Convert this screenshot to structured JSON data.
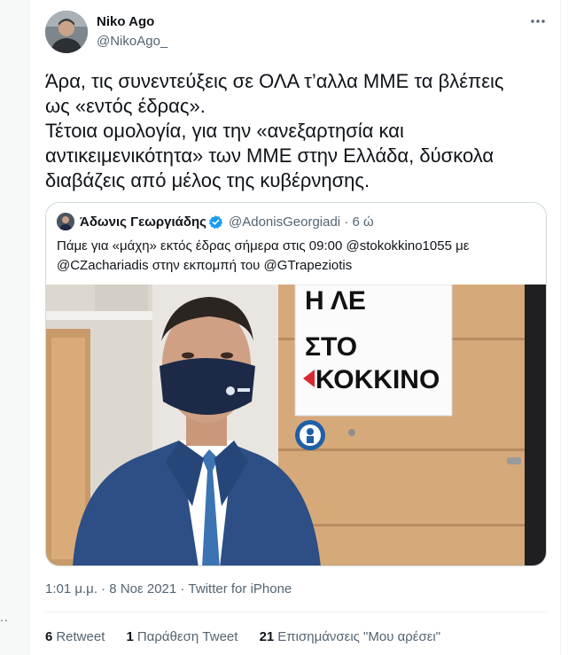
{
  "tweet": {
    "author_name": "Niko Ago",
    "author_handle": "@NikoAgo_",
    "more_icon": "more-horizontal-icon",
    "text_lines": [
      "Άρα, τις συνεντεύξεις σε ΟΛΑ τ’αλλα ΜΜΕ τα βλέπεις",
      "ως «εντός έδρας».",
      "Τέτοια ομολογία, για την «ανεξαρτησία και",
      "αντικειμενικότητα» των ΜΜΕ στην Ελλάδα, δύσκολα",
      "διαβάζεις από μέλος της κυβέρνησης."
    ],
    "timestamp": "1:01 μ.μ. · 8 Νοε 2021 · Twitter for iPhone"
  },
  "quote": {
    "author_name": "Άδωνις Γεωργιάδης",
    "meta": "@AdonisGeorgiadi · 6 ώ",
    "verified_icon": "verified-badge-icon",
    "text_line1": "Πάμε για «μάχη» εκτός έδρας σήμερα στις 09:00 @stokokkino1055 με",
    "text_line2": "@CZachariadis στην εκπομπή του @GTrapeziotis",
    "photo_sign_line1": "Η ΛΕ",
    "photo_sign_line2": "ΣΤΟ",
    "photo_sign_line3": "ΚΟΚΚΙΝΟ"
  },
  "stats": {
    "retweets_count": "6",
    "retweets_label": "Retweet",
    "quotes_count": "1",
    "quotes_label": "Παράθεση Tweet",
    "likes_count": "21",
    "likes_label": "Επισημάνσεις \"Μου αρέσει\""
  },
  "left_dots": "..",
  "colors": {
    "text_primary": "#0f1419",
    "text_secondary": "#536471",
    "border": "#cfd9de",
    "verified_blue": "#1d9bf0",
    "sign_red": "#d9282f"
  }
}
